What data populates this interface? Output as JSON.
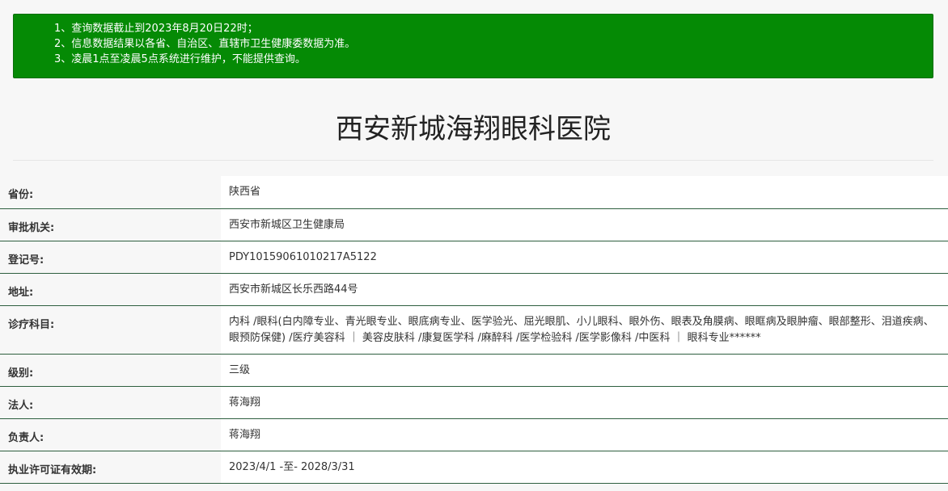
{
  "notice": {
    "lines": [
      "1、查询数据截止到2023年8月20日22时；",
      "2、信息数据结果以各省、自治区、直辖市卫生健康委数据为准。",
      "3、凌晨1点至凌晨5点系统进行维护，不能提供查询。"
    ]
  },
  "hospital_name": "西安新城海翔眼科医院",
  "fields": [
    {
      "label": "省份:",
      "value": "陕西省"
    },
    {
      "label": "审批机关:",
      "value": "西安市新城区卫生健康局"
    },
    {
      "label": "登记号:",
      "value": "PDY10159061010217A5122"
    },
    {
      "label": "地址:",
      "value": "西安市新城区长乐西路44号"
    },
    {
      "label": "诊疗科目:",
      "value": "内科 /眼科(白内障专业、青光眼专业、眼底病专业、医学验光、屈光眼肌、小儿眼科、眼外伤、眼表及角膜病、眼眶病及眼肿瘤、眼部整形、泪道疾病、眼预防保健) /医疗美容科 ｜ 美容皮肤科 /康复医学科 /麻醉科 /医学检验科 /医学影像科 /中医科 ｜ 眼科专业******"
    },
    {
      "label": "级别:",
      "value": "三级"
    },
    {
      "label": "法人:",
      "value": "蒋海翔"
    },
    {
      "label": "负责人:",
      "value": "蒋海翔"
    },
    {
      "label": "执业许可证有效期:",
      "value": "2023/4/1 -至- 2028/3/31"
    }
  ],
  "colors": {
    "notice_bg": "#058a05",
    "row_border": "#2e5f3f"
  }
}
